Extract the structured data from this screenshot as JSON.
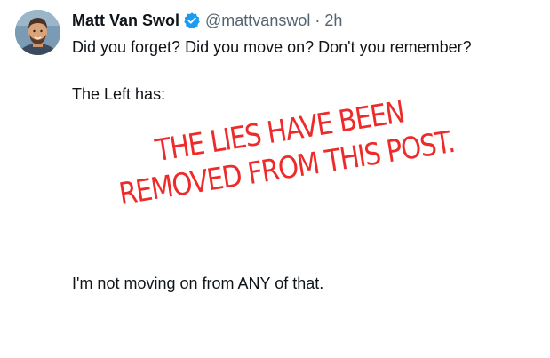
{
  "author": {
    "name": "Matt Van Swol",
    "handle": "@mattvanswol",
    "separator": "·",
    "time": "2h",
    "verified_badge_color": "#1d9bf0"
  },
  "tweet": {
    "line1": "Did you forget? Did you move on? Don't you remember?",
    "line2": "The Left has:",
    "line3": "I'm not moving on from ANY of that."
  },
  "overlay": {
    "line1": "THE LIES HAVE BEEN",
    "line2": "REMOVED FROM THIS POST.",
    "color": "#ee2b2b"
  },
  "icons": {
    "verified": "verified-badge-icon",
    "avatar": "avatar"
  }
}
